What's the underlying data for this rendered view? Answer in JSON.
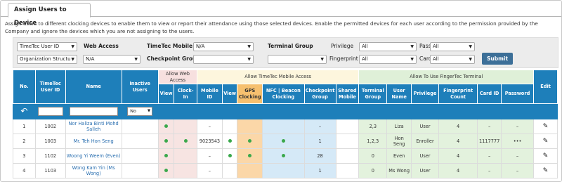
{
  "tab": {
    "label": "Assign Users to Device"
  },
  "description": "Assign users to different clocking devices to enable them to view or report their attendance using those selected devices. Enable the permitted devices for each user according to the permission provided by the Company and ignore the devices which you are not assigning to the users.",
  "filters": {
    "id_type": "TimeTec User ID",
    "org_structure": "Organization Structu",
    "web_access_label": "Web Access",
    "web_access_value": "N/A",
    "mobile_label": "TimeTec Mobile",
    "mobile_value": "N/A",
    "checkpoint_label": "Checkpoint Group",
    "checkpoint_value": "",
    "terminal_label": "Terminal Group",
    "terminal_value": "",
    "privilege_label": "Privilege",
    "privilege_value": "All",
    "fingerprint_label": "Fingerprint",
    "fingerprint_value": "All",
    "password_label": "Password",
    "password_value": "All",
    "card_label": "Card",
    "card_value": "All",
    "submit_label": "Submit"
  },
  "table": {
    "headers": {
      "no": "No.",
      "user_id": "TimeTec User ID",
      "name": "Name",
      "inactive": "Inactive Users",
      "allow_web": "Allow Web Access",
      "allow_mobile": "Allow TimeTec Mobile Access",
      "allow_fingertec": "Allow To Use FingerTec Terminal",
      "edit": "Edit",
      "view": "View",
      "clock_in": "Clock-In",
      "mobile_id": "Mobile ID",
      "view2": "View",
      "gps": "GPS Clocking",
      "nfc": "NFC | Beacon Clocking",
      "checkpoint_group": "Checkpoint Group",
      "shared_mobile": "Shared Mobile",
      "terminal_group": "Terminal Group",
      "user_name": "User Name",
      "privilege": "Privilege",
      "fp_count": "Fingerprint Count",
      "card_id": "Card ID",
      "password": "Password"
    },
    "filter_row": {
      "undo_icon": "↶",
      "inactive_value": "No"
    },
    "rows": [
      {
        "no": "1",
        "user_id": "1002",
        "name": "Nor Haliza Binti Mohd Salleh",
        "web_view": true,
        "web_clock": false,
        "mobile_id": "–",
        "m_view": false,
        "gps": false,
        "nfc": false,
        "checkpoint": "–",
        "terminal_group": "2,3",
        "user_name": "Liza",
        "privilege": "User",
        "fp_count": "4",
        "card_id": "–",
        "password": "–"
      },
      {
        "no": "2",
        "user_id": "1003",
        "name": "Mr. Teh Hon Seng",
        "web_view": true,
        "web_clock": true,
        "mobile_id": "9023543",
        "m_view": true,
        "gps": true,
        "nfc": true,
        "checkpoint": "1",
        "terminal_group": "1,2,3",
        "user_name": "Hon Seng",
        "privilege": "Enroller",
        "fp_count": "4",
        "card_id": "1117777",
        "password": "•••"
      },
      {
        "no": "3",
        "user_id": "1102",
        "name": "Woong Yi Weem (Even)",
        "web_view": true,
        "web_clock": false,
        "mobile_id": "–",
        "m_view": true,
        "gps": true,
        "nfc": true,
        "checkpoint": "28",
        "terminal_group": "0",
        "user_name": "Even",
        "privilege": "User",
        "fp_count": "4",
        "card_id": "–",
        "password": "–"
      },
      {
        "no": "4",
        "user_id": "1103",
        "name": "Wong Kam Yin (Ms Wong)",
        "web_view": true,
        "web_clock": false,
        "mobile_id": "–",
        "m_view": false,
        "gps": false,
        "nfc": false,
        "checkpoint": "1",
        "terminal_group": "0",
        "user_name": "Ms Wong",
        "privilege": "User",
        "fp_count": "4",
        "card_id": "–",
        "password": "–"
      }
    ]
  },
  "colors": {
    "header_blue": "#1e7fba",
    "submit_blue": "#3c6f98",
    "dot_green": "#3aa84b",
    "gps_orange": "#f6c06f"
  }
}
